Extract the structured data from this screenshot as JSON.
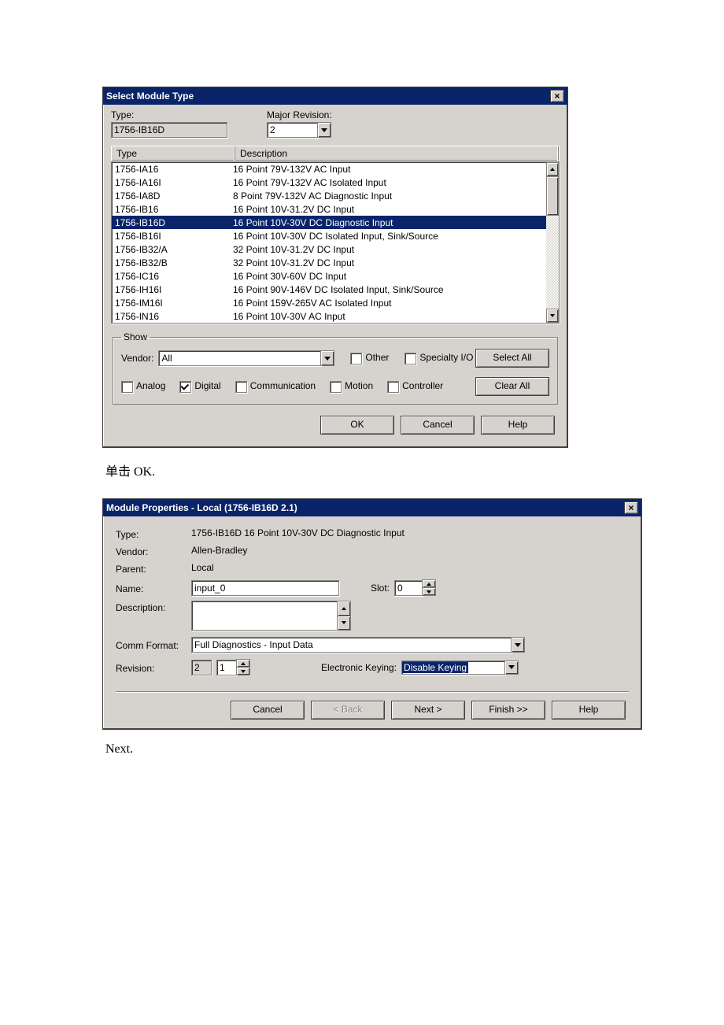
{
  "dialog1": {
    "title": "Select Module Type",
    "type_label": "Type:",
    "type_value": "1756-IB16D",
    "major_rev_label": "Major Revision:",
    "major_rev_value": "2",
    "col_type": "Type",
    "col_desc": "Description",
    "rows": [
      {
        "type": "1756-IA16",
        "desc": "16 Point 79V-132V AC Input"
      },
      {
        "type": "1756-IA16I",
        "desc": "16 Point 79V-132V AC Isolated Input"
      },
      {
        "type": "1756-IA8D",
        "desc": "8 Point 79V-132V AC Diagnostic Input"
      },
      {
        "type": "1756-IB16",
        "desc": "16 Point 10V-31.2V DC Input"
      },
      {
        "type": "1756-IB16D",
        "desc": "16 Point 10V-30V DC Diagnostic Input",
        "selected": true
      },
      {
        "type": "1756-IB16I",
        "desc": "16 Point 10V-30V DC Isolated Input, Sink/Source"
      },
      {
        "type": "1756-IB32/A",
        "desc": "32 Point 10V-31.2V DC Input"
      },
      {
        "type": "1756-IB32/B",
        "desc": "32 Point 10V-31.2V DC Input"
      },
      {
        "type": "1756-IC16",
        "desc": "16 Point 30V-60V DC Input"
      },
      {
        "type": "1756-IH16I",
        "desc": "16 Point 90V-146V DC Isolated Input, Sink/Source"
      },
      {
        "type": "1756-IM16I",
        "desc": "16 Point 159V-265V AC Isolated Input"
      },
      {
        "type": "1756-IN16",
        "desc": "16 Point 10V-30V AC Input"
      }
    ],
    "show": {
      "legend": "Show",
      "vendor_label": "Vendor:",
      "vendor_value": "All",
      "other": "Other",
      "specialty": "Specialty I/O",
      "select_all": "Select All",
      "analog": "Analog",
      "digital": "Digital",
      "communication": "Communication",
      "motion": "Motion",
      "controller": "Controller",
      "clear_all": "Clear All"
    },
    "buttons": {
      "ok": "OK",
      "cancel": "Cancel",
      "help": "Help"
    }
  },
  "caption1": "单击 OK.",
  "dialog2": {
    "title": "Module Properties - Local (1756-IB16D 2.1)",
    "type_label": "Type:",
    "type_value": "1756-IB16D 16 Point 10V-30V DC Diagnostic Input",
    "vendor_label": "Vendor:",
    "vendor_value": "Allen-Bradley",
    "parent_label": "Parent:",
    "parent_value": "Local",
    "name_label": "Name:",
    "name_value": "input_0",
    "slot_label": "Slot:",
    "slot_value": "0",
    "desc_label": "Description:",
    "desc_value": "",
    "comm_label": "Comm Format:",
    "comm_value": "Full Diagnostics - Input Data",
    "rev_label": "Revision:",
    "rev_major": "2",
    "rev_minor": "1",
    "keying_label": "Electronic Keying:",
    "keying_value": "Disable Keying",
    "buttons": {
      "cancel": "Cancel",
      "back": "< Back",
      "next": "Next >",
      "finish": "Finish >>",
      "help": "Help"
    }
  },
  "caption2": "Next."
}
